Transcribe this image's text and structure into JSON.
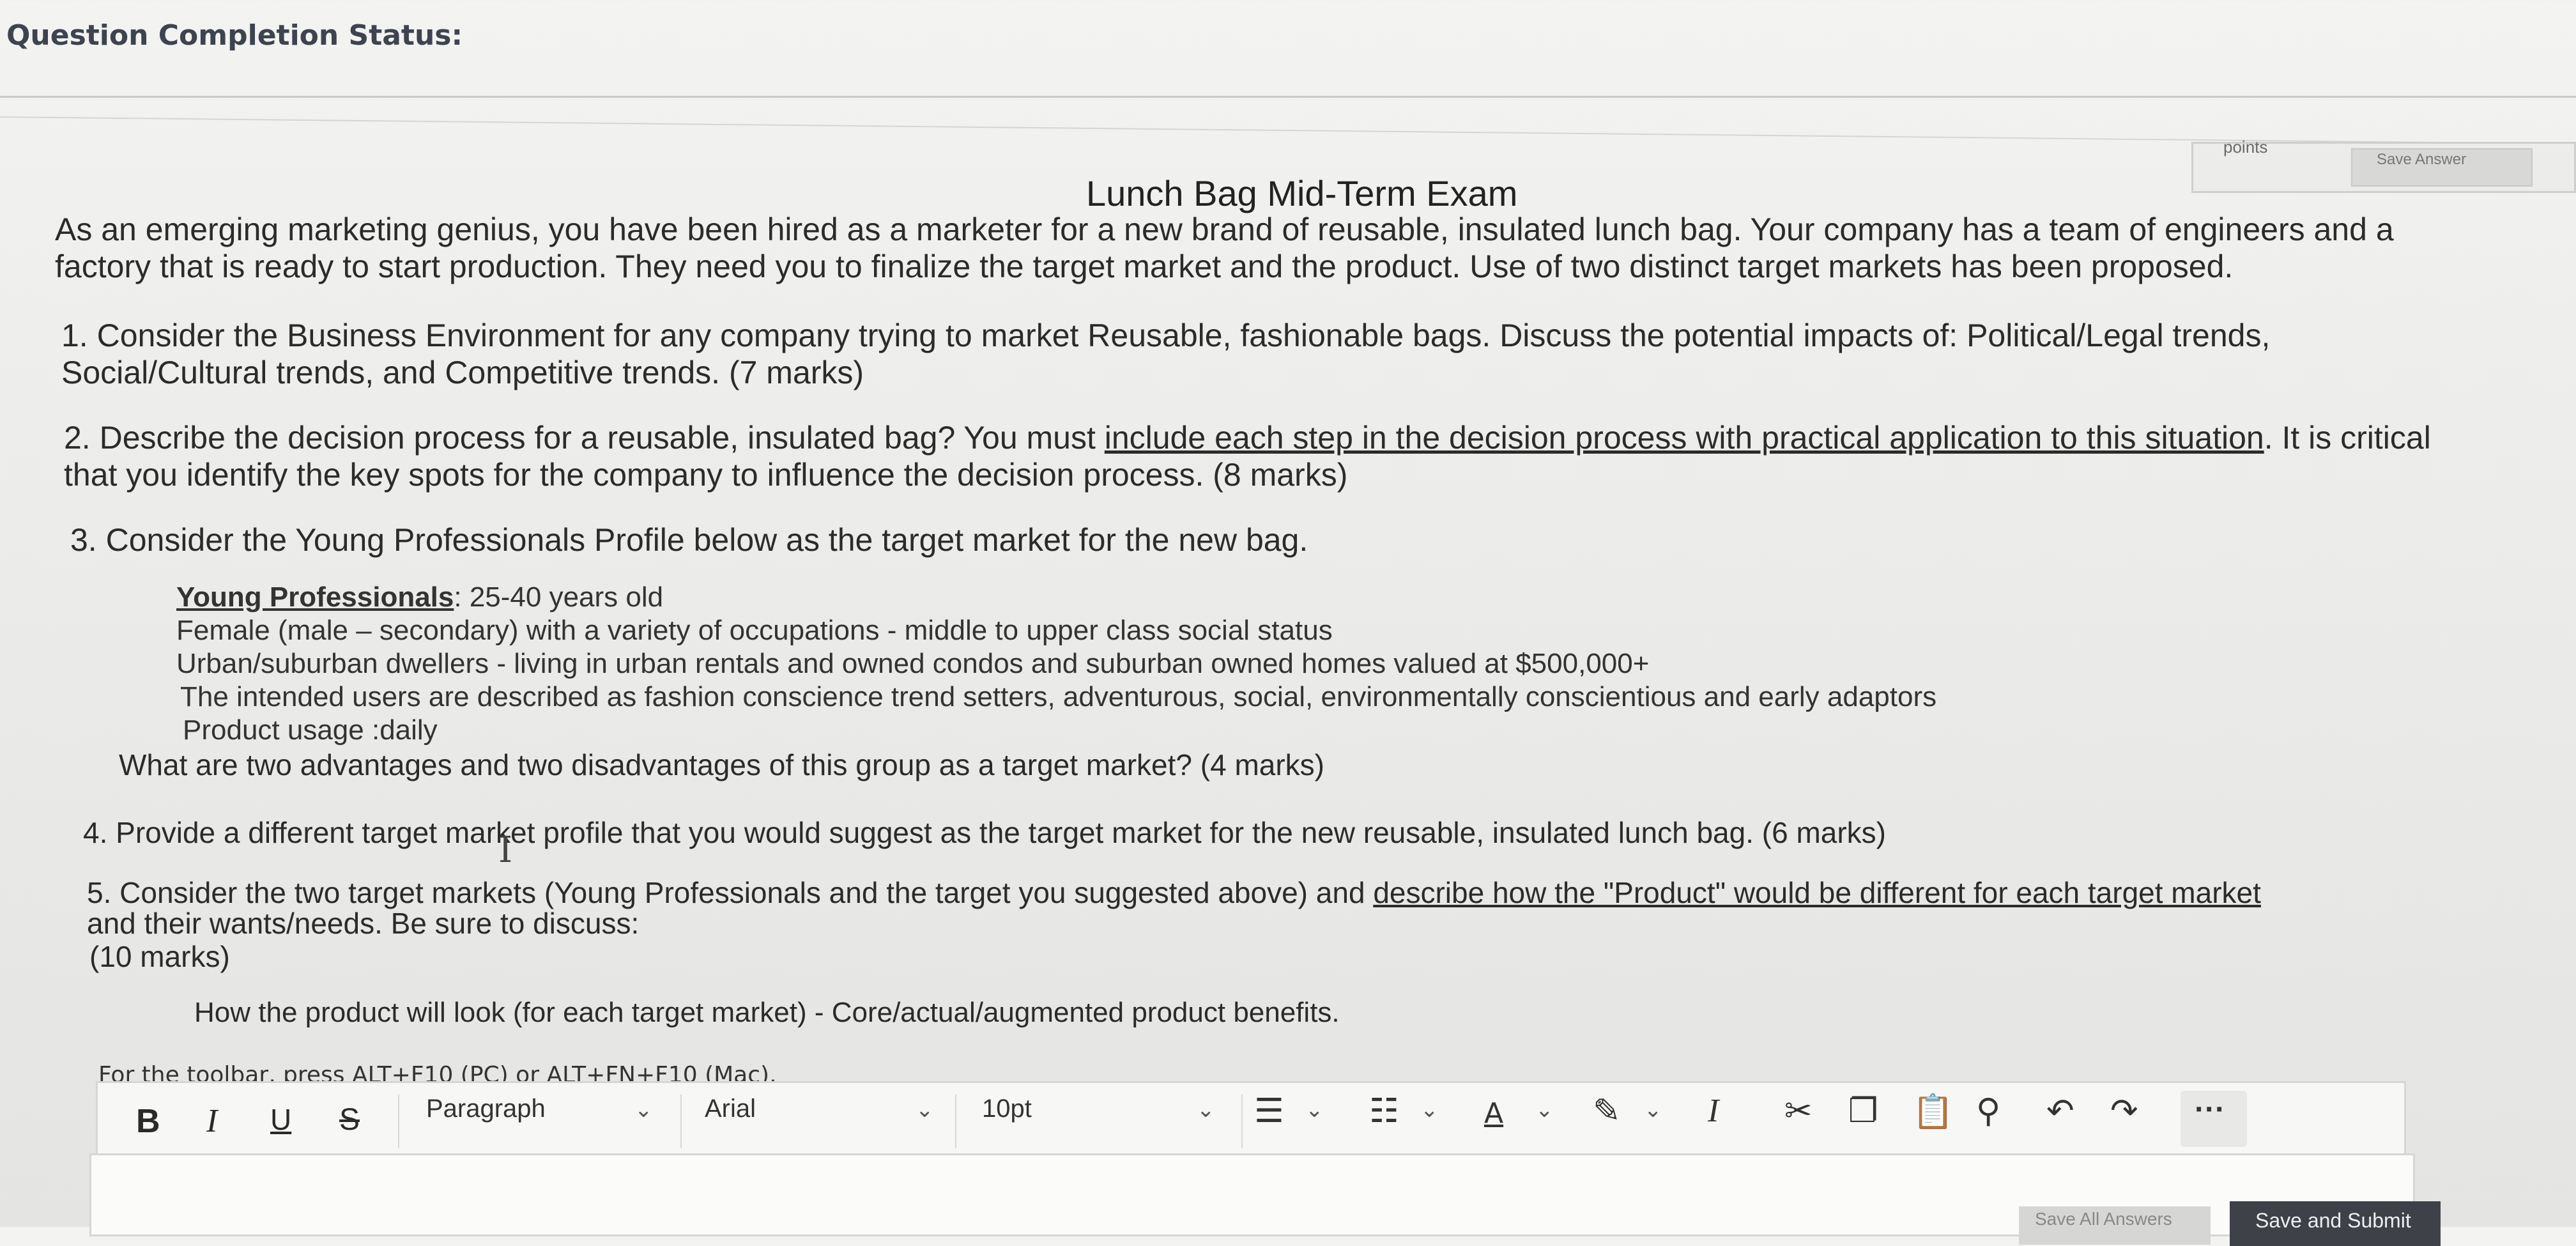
{
  "header": {
    "status_label": "Question Completion Status:"
  },
  "points_area": {
    "label": "points",
    "save_answer": "Save Answer"
  },
  "exam": {
    "title": "Lunch Bag Mid-Term Exam",
    "intro_line1": "As an emerging marketing genius, you have been hired as a marketer for a new brand of reusable, insulated lunch bag. Your company has a team of engineers and a",
    "intro_line2": "factory that is ready to start production. They need you to finalize the target market and the product. Use of two distinct target markets has been proposed.",
    "q1_line1": "1. Consider the Business Environment for any company trying to market Reusable, fashionable bags. Discuss the potential impacts of: Political/Legal trends,",
    "q1_line2": "Social/Cultural trends, and Competitive trends. (7 marks)",
    "q2_line1_prefix": "2. Describe the decision process for a reusable, insulated bag? You must ",
    "q2_line1_underlined": "include each step in the decision process with practical application to this situation",
    "q2_line1_suffix": ". It is critical",
    "q2_line2": "that you identify the key spots for the company to influence the decision process. (8 marks)",
    "q3": "3. Consider the Young Professionals Profile below as the target market for the new bag.",
    "profile_head": "Young Professionals",
    "profile_age": ": 25-40 years old",
    "profile_gender": "Female (male – secondary) with a variety of occupations - middle to upper class social status",
    "profile_location": "Urban/suburban dwellers - living in urban rentals and owned condos and suburban owned homes  valued at $500,000+",
    "profile_users": "The intended users are described as fashion conscience trend setters, adventurous, social, environmentally conscientious and early adaptors",
    "profile_usage": "Product usage :daily",
    "q3_question": "What are two advantages and two disadvantages of this group as a target market? (4 marks)",
    "q4": "4. Provide a different target market profile that you would suggest as the target market for the new reusable, insulated lunch bag. (6 marks)",
    "q5_line1_prefix": "5. Consider the two target markets (Young Professionals and the target you suggested above) and ",
    "q5_line1_underlined": "describe how the \"Product\" would be different for each target market",
    "q5_line2": "and their wants/needs. Be sure to discuss:",
    "q5_line3": "(10 marks)",
    "q5_point": "How the product will look (for each target market) - Core/actual/augmented product benefits."
  },
  "editor": {
    "toolbar_hint": "For the toolbar, press ALT+F10 (PC) or ALT+FN+F10 (Mac).",
    "bold": "B",
    "italic": "I",
    "underline": "U",
    "strike": "S",
    "paragraph": "Paragraph",
    "font": "Arial",
    "size": "10pt",
    "more": "···"
  },
  "footer": {
    "save_all": "Save All Answers",
    "save_submit": "Save and Submit"
  }
}
